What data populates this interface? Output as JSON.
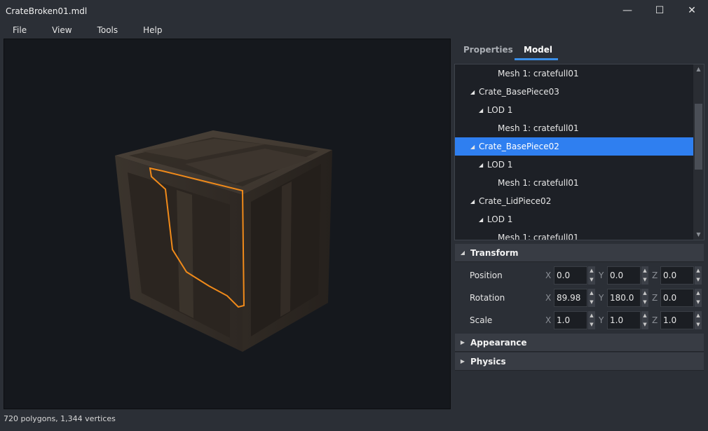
{
  "window": {
    "title": "CrateBroken01.mdl",
    "minimize_glyph": "—",
    "maximize_glyph": "☐",
    "close_glyph": "✕"
  },
  "menu": [
    "File",
    "View",
    "Tools",
    "Help"
  ],
  "status": "720 polygons, 1,344 vertices",
  "tabs": [
    {
      "label": "Properties",
      "active": false
    },
    {
      "label": "Model",
      "active": true
    }
  ],
  "tree": [
    {
      "label": "Mesh 1: cratefull01",
      "level": 2,
      "expanded": null,
      "selected": false
    },
    {
      "label": "Crate_BasePiece03",
      "level": 0,
      "expanded": true,
      "selected": false
    },
    {
      "label": "LOD 1",
      "level": 1,
      "expanded": true,
      "selected": false
    },
    {
      "label": "Mesh 1: cratefull01",
      "level": 2,
      "expanded": null,
      "selected": false
    },
    {
      "label": "Crate_BasePiece02",
      "level": 0,
      "expanded": true,
      "selected": true
    },
    {
      "label": "LOD 1",
      "level": 1,
      "expanded": true,
      "selected": false
    },
    {
      "label": "Mesh 1: cratefull01",
      "level": 2,
      "expanded": null,
      "selected": false
    },
    {
      "label": "Crate_LidPiece02",
      "level": 0,
      "expanded": true,
      "selected": false
    },
    {
      "label": "LOD 1",
      "level": 1,
      "expanded": true,
      "selected": false
    },
    {
      "label": "Mesh 1: cratefull01",
      "level": 2,
      "expanded": null,
      "selected": false
    }
  ],
  "sections": {
    "transform": "Transform",
    "appearance": "Appearance",
    "physics": "Physics"
  },
  "axes": {
    "x": "X",
    "y": "Y",
    "z": "Z"
  },
  "transform": [
    {
      "label": "Position",
      "x": "0.0",
      "y": "0.0",
      "z": "0.0"
    },
    {
      "label": "Rotation",
      "x": "89.98",
      "y": "180.0",
      "z": "0.0"
    },
    {
      "label": "Scale",
      "x": "1.0",
      "y": "1.0",
      "z": "1.0"
    }
  ],
  "colors": {
    "accent": "#2f7ff0",
    "tab_underline": "#3a8ee6",
    "selection_outline": "#f08a1a"
  }
}
